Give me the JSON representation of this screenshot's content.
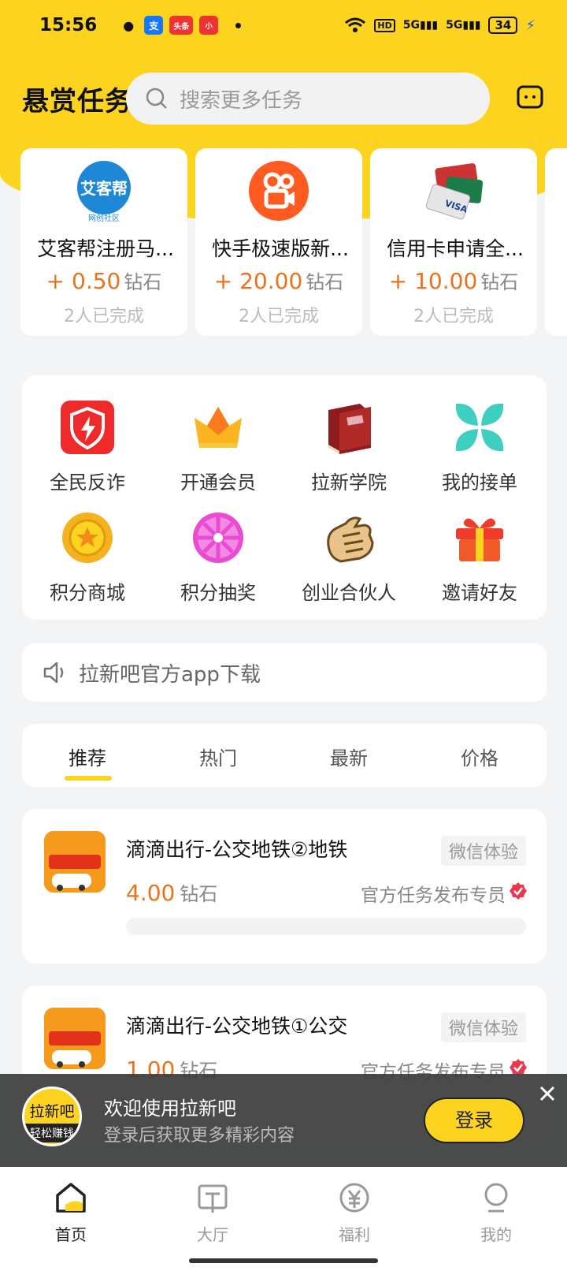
{
  "status_bar": {
    "time": "15:56",
    "network": "5G",
    "battery": "34"
  },
  "header": {
    "title": "悬赏任务",
    "search_placeholder": "搜索更多任务"
  },
  "featured_tasks": [
    {
      "title": "艾客帮注册马...",
      "reward": "+ 0.50",
      "unit": "钻石",
      "done": "2人已完成",
      "icon": "aikebang-logo"
    },
    {
      "title": "快手极速版新...",
      "reward": "+ 20.00",
      "unit": "钻石",
      "done": "2人已完成",
      "icon": "kuaishou-logo"
    },
    {
      "title": "信用卡申请全...",
      "reward": "+ 10.00",
      "unit": "钻石",
      "done": "2人已完成",
      "icon": "credit-card-icon"
    }
  ],
  "grid": [
    {
      "label": "全民反诈",
      "icon": "shield-icon"
    },
    {
      "label": "开通会员",
      "icon": "crown-icon"
    },
    {
      "label": "拉新学院",
      "icon": "book-icon"
    },
    {
      "label": "我的接单",
      "icon": "clover-icon"
    },
    {
      "label": "积分商城",
      "icon": "medal-icon"
    },
    {
      "label": "积分抽奖",
      "icon": "wheel-icon"
    },
    {
      "label": "创业合伙人",
      "icon": "hand-icon"
    },
    {
      "label": "邀请好友",
      "icon": "gift-icon"
    }
  ],
  "notice": {
    "text": "拉新吧官方app下载"
  },
  "tabs": [
    "推荐",
    "热门",
    "最新",
    "价格"
  ],
  "tasks": [
    {
      "title": "滴滴出行-公交地铁②地铁",
      "tag": "微信体验",
      "price": "4.00",
      "unit": "钻石",
      "publisher": "官方任务发布专员"
    },
    {
      "title": "滴滴出行-公交地铁①公交",
      "tag": "微信体验",
      "price": "1.00",
      "unit": "钻石",
      "publisher": "官方任务发布专员"
    }
  ],
  "banner": {
    "avatar_top": "拉新吧",
    "avatar_bottom": "轻松赚钱",
    "title": "欢迎使用拉新吧",
    "subtitle": "登录后获取更多精彩内容",
    "login": "登录"
  },
  "bottom_nav": [
    {
      "label": "首页",
      "icon": "home-icon"
    },
    {
      "label": "大厅",
      "icon": "hall-icon"
    },
    {
      "label": "福利",
      "icon": "yen-icon"
    },
    {
      "label": "我的",
      "icon": "profile-icon"
    }
  ],
  "colors": {
    "brand_yellow": "#fcd31f",
    "reward_orange": "#e9731c",
    "verify_red": "#e8384f"
  }
}
